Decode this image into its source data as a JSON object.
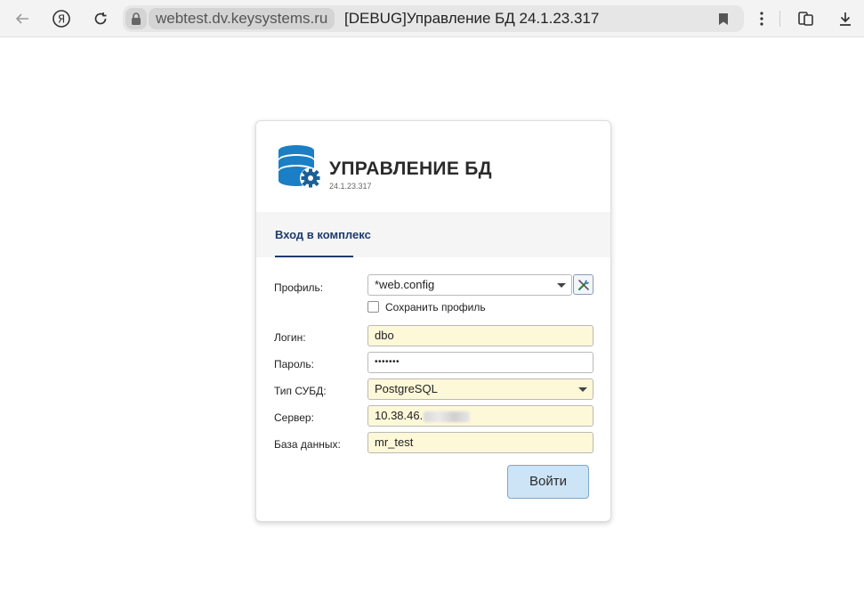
{
  "browser": {
    "host": "webtest.dv.keysystems.ru",
    "tab_title": "[DEBUG]Управление БД 24.1.23.317"
  },
  "app": {
    "title": "УПРАВЛЕНИЕ БД",
    "version": "24.1.23.317",
    "accent_color": "#1f3b6d",
    "logo_color": "#1a7fc4"
  },
  "tabs": [
    {
      "label": "Вход в комплекс",
      "active": true
    }
  ],
  "form": {
    "profile": {
      "label": "Профиль:",
      "value": "*web.config"
    },
    "save_profile": {
      "label": "Сохранить профиль",
      "checked": false
    },
    "login": {
      "label": "Логин:",
      "value": "dbo"
    },
    "password": {
      "label": "Пароль:",
      "value": "•••••••"
    },
    "dbms_type": {
      "label": "Тип СУБД:",
      "value": "PostgreSQL"
    },
    "server": {
      "label": "Сервер:",
      "value": "10.38.46."
    },
    "database": {
      "label": "База данных:",
      "value": "mr_test"
    },
    "submit_label": "Войти"
  }
}
